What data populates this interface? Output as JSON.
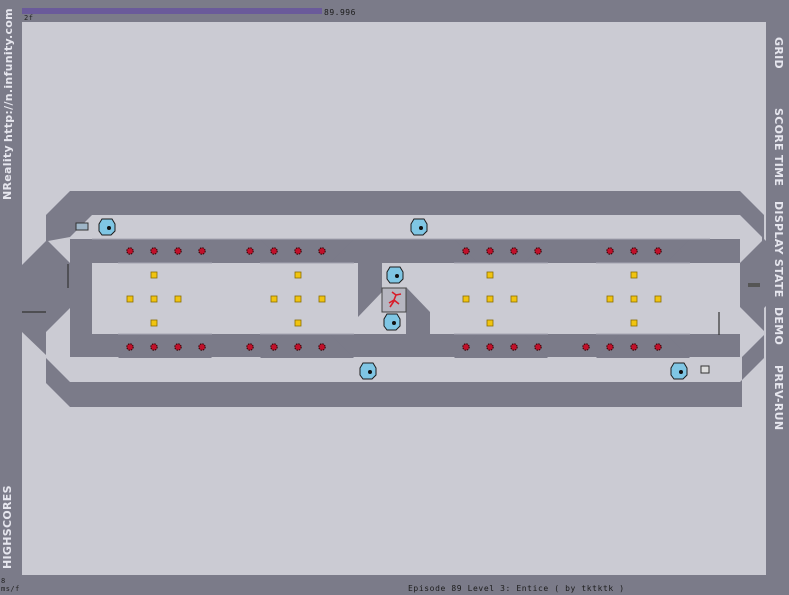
{
  "hud": {
    "time_value": "89.996",
    "time_fraction": 1.0,
    "frame_label": "2f",
    "fps_a": "8",
    "fps_b": "ms/f",
    "episode": "Episode 89 Level 3: Entice ( by tktktk )"
  },
  "left_menu": {
    "site": "http://n.infunity.com",
    "brand": "NReality",
    "highscores": "HIGHSCORES"
  },
  "right_menu": {
    "grid": "GRID",
    "score_time": "SCORE TIME",
    "display_state": "DISPLAY STATE",
    "demo": "DEMO",
    "prev_run": "PREV-RUN"
  },
  "colors": {
    "wall": "#7b7b89",
    "floor": "#cbcbd3",
    "drone": "#7fc6e4",
    "gold": "#f1c40f",
    "mine": "#c0102a",
    "ninja": "#d81d2a"
  }
}
